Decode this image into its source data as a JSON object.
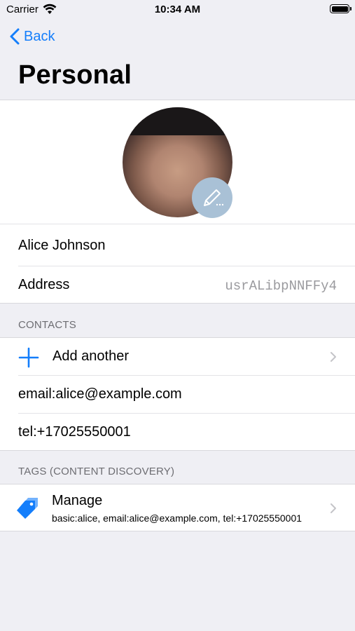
{
  "status_bar": {
    "carrier": "Carrier",
    "time": "10:34 AM"
  },
  "nav": {
    "back_label": "Back",
    "title": "Personal"
  },
  "profile": {
    "name": "Alice Johnson",
    "address_label": "Address",
    "address_value": "usrALibpNNFFy4"
  },
  "contacts": {
    "header": "CONTACTS",
    "add_label": "Add another",
    "items": [
      "email:alice@example.com",
      "tel:+17025550001"
    ]
  },
  "tags": {
    "header": "TAGS (CONTENT DISCOVERY)",
    "manage_title": "Manage",
    "manage_subtitle": "basic:alice, email:alice@example.com, tel:+17025550001"
  },
  "icons": {
    "back": "chevron-left-icon",
    "edit": "pencil-icon",
    "add": "plus-icon",
    "tag": "tag-icon",
    "disclosure": "chevron-right-icon"
  },
  "colors": {
    "accent": "#147efb",
    "background": "#efeff4",
    "secondary_text": "#6d6d72"
  }
}
